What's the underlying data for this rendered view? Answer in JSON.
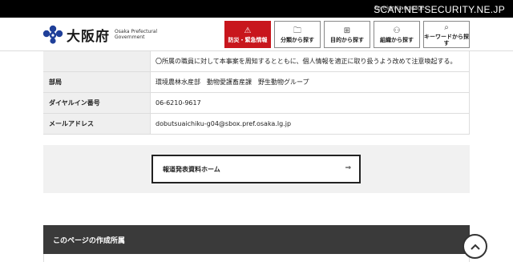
{
  "topbar": {
    "small_text": "Foreign Language",
    "watermark": "SCAN:NETSECURITY.NE.JP"
  },
  "header": {
    "logo_name": "大阪府",
    "logo_en_1": "Osaka Prefectural",
    "logo_en_2": "Government",
    "nav": [
      {
        "label": "防災・緊急情報",
        "icon": "warning-icon"
      },
      {
        "label": "分類から探す",
        "icon": "folder-search-icon"
      },
      {
        "label": "目的から探す",
        "icon": "grid-icon"
      },
      {
        "label": "組織から探す",
        "icon": "org-chart-icon"
      },
      {
        "label": "キーワードから探す",
        "icon": "search-icon"
      }
    ]
  },
  "table": {
    "rows": [
      {
        "label": "",
        "value": "〇所属の職員に対して本事案を周知するとともに、個人情報を適正に取り扱うよう改めて注意喚起する。"
      },
      {
        "label": "部局",
        "value": "環境農林水産部　動物愛護畜産課　野生動物グループ"
      },
      {
        "label": "ダイヤルイン番号",
        "value": "06-6210-9617"
      },
      {
        "label": "メールアドレス",
        "value": "dobutsuaichiku-g04@sbox.pref.osaka.lg.jp"
      }
    ]
  },
  "link_button": {
    "label": "報道発表資料ホーム",
    "arrow": "⇒"
  },
  "section": {
    "title": "このページの作成所属"
  },
  "colors": {
    "red": "#c8161d",
    "dark": "#3a3a3a"
  }
}
